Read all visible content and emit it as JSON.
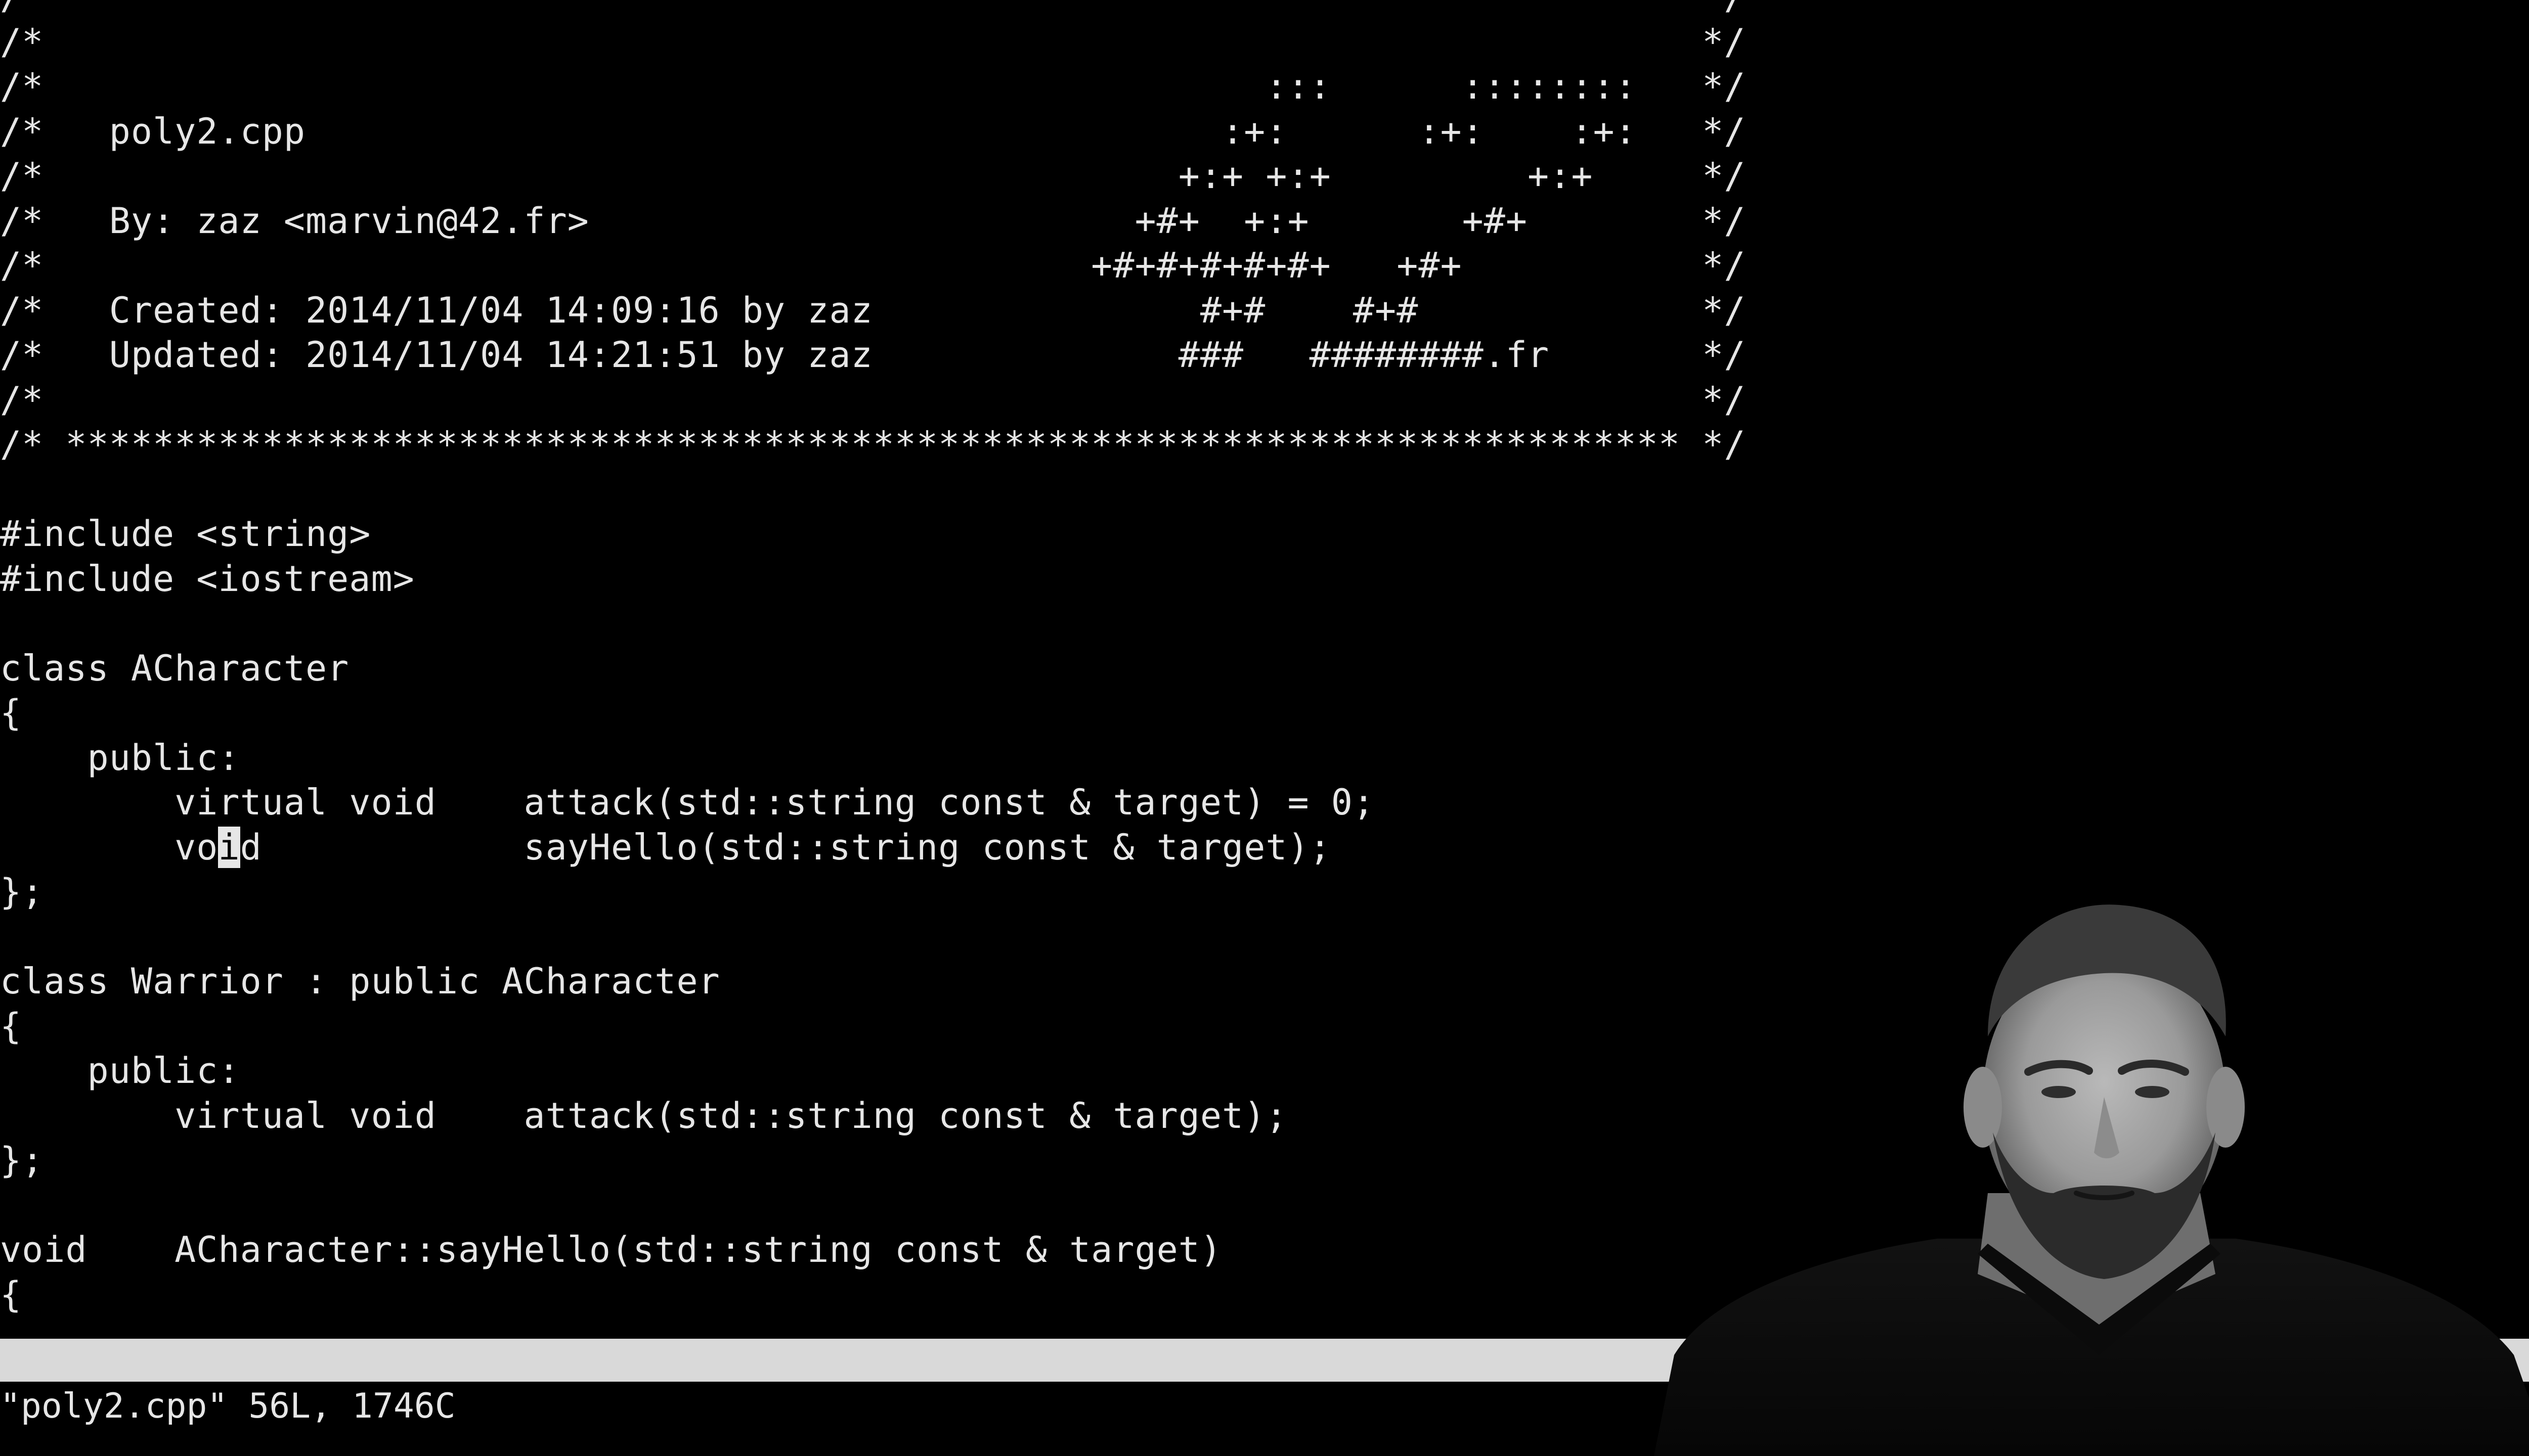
{
  "editor": {
    "cursor": {
      "line": 19,
      "char": 10
    },
    "lines": [
      "/* ************************************************************************** */",
      "/*                                                                            */",
      "/*                                                        :::      ::::::::   */",
      "/*   poly2.cpp                                          :+:      :+:    :+:   */",
      "/*                                                    +:+ +:+         +:+     */",
      "/*   By: zaz <marvin@42.fr>                         +#+  +:+       +#+        */",
      "/*                                                +#+#+#+#+#+   +#+           */",
      "/*   Created: 2014/11/04 14:09:16 by zaz               #+#    #+#             */",
      "/*   Updated: 2014/11/04 14:21:51 by zaz              ###   ########.fr       */",
      "/*                                                                            */",
      "/* ************************************************************************** */",
      "",
      "#include <string>",
      "#include <iostream>",
      "",
      "class ACharacter",
      "{",
      "    public:",
      "        virtual void    attack(std::string const & target) = 0;",
      "        void            sayHello(std::string const & target);",
      "};",
      "",
      "class Warrior : public ACharacter",
      "{",
      "    public:",
      "        virtual void    attack(std::string const & target);",
      "};",
      "",
      "void    ACharacter::sayHello(std::string const & target)",
      "{"
    ]
  },
  "status_bar": {
    "filename": "poly2.cpp"
  },
  "message_line": {
    "text": "\"poly2.cpp\" 56L, 1746C"
  },
  "webcam": {
    "description_icon": "presenter-video-overlay"
  }
}
